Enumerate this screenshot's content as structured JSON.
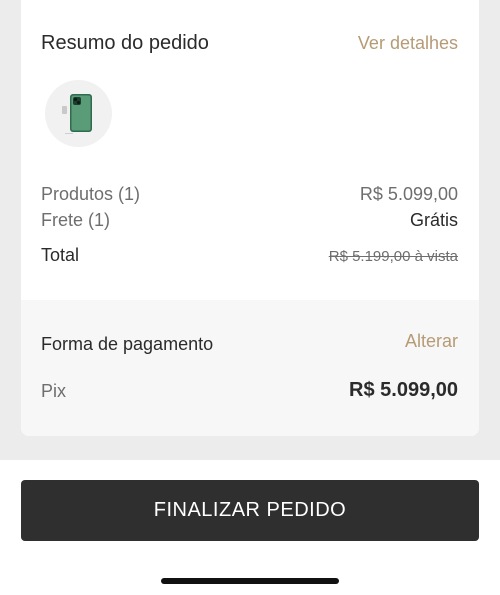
{
  "summary": {
    "title": "Resumo do pedido",
    "details_link": "Ver detalhes",
    "product_icon": "iphone-thumbnail-icon",
    "products_label": "Produtos (1)",
    "products_value": "R$ 5.099,00",
    "shipping_label": "Frete (1)",
    "shipping_value": "Grátis",
    "total_label": "Total",
    "total_value": "R$ 5.199,00 à vista"
  },
  "payment": {
    "title": "Forma de pagamento",
    "change_link": "Alterar",
    "method": "Pix",
    "amount": "R$ 5.099,00"
  },
  "cta": {
    "label": "FINALIZAR PEDIDO"
  },
  "colors": {
    "accent": "#b69b76",
    "button": "#2f2f2f"
  }
}
